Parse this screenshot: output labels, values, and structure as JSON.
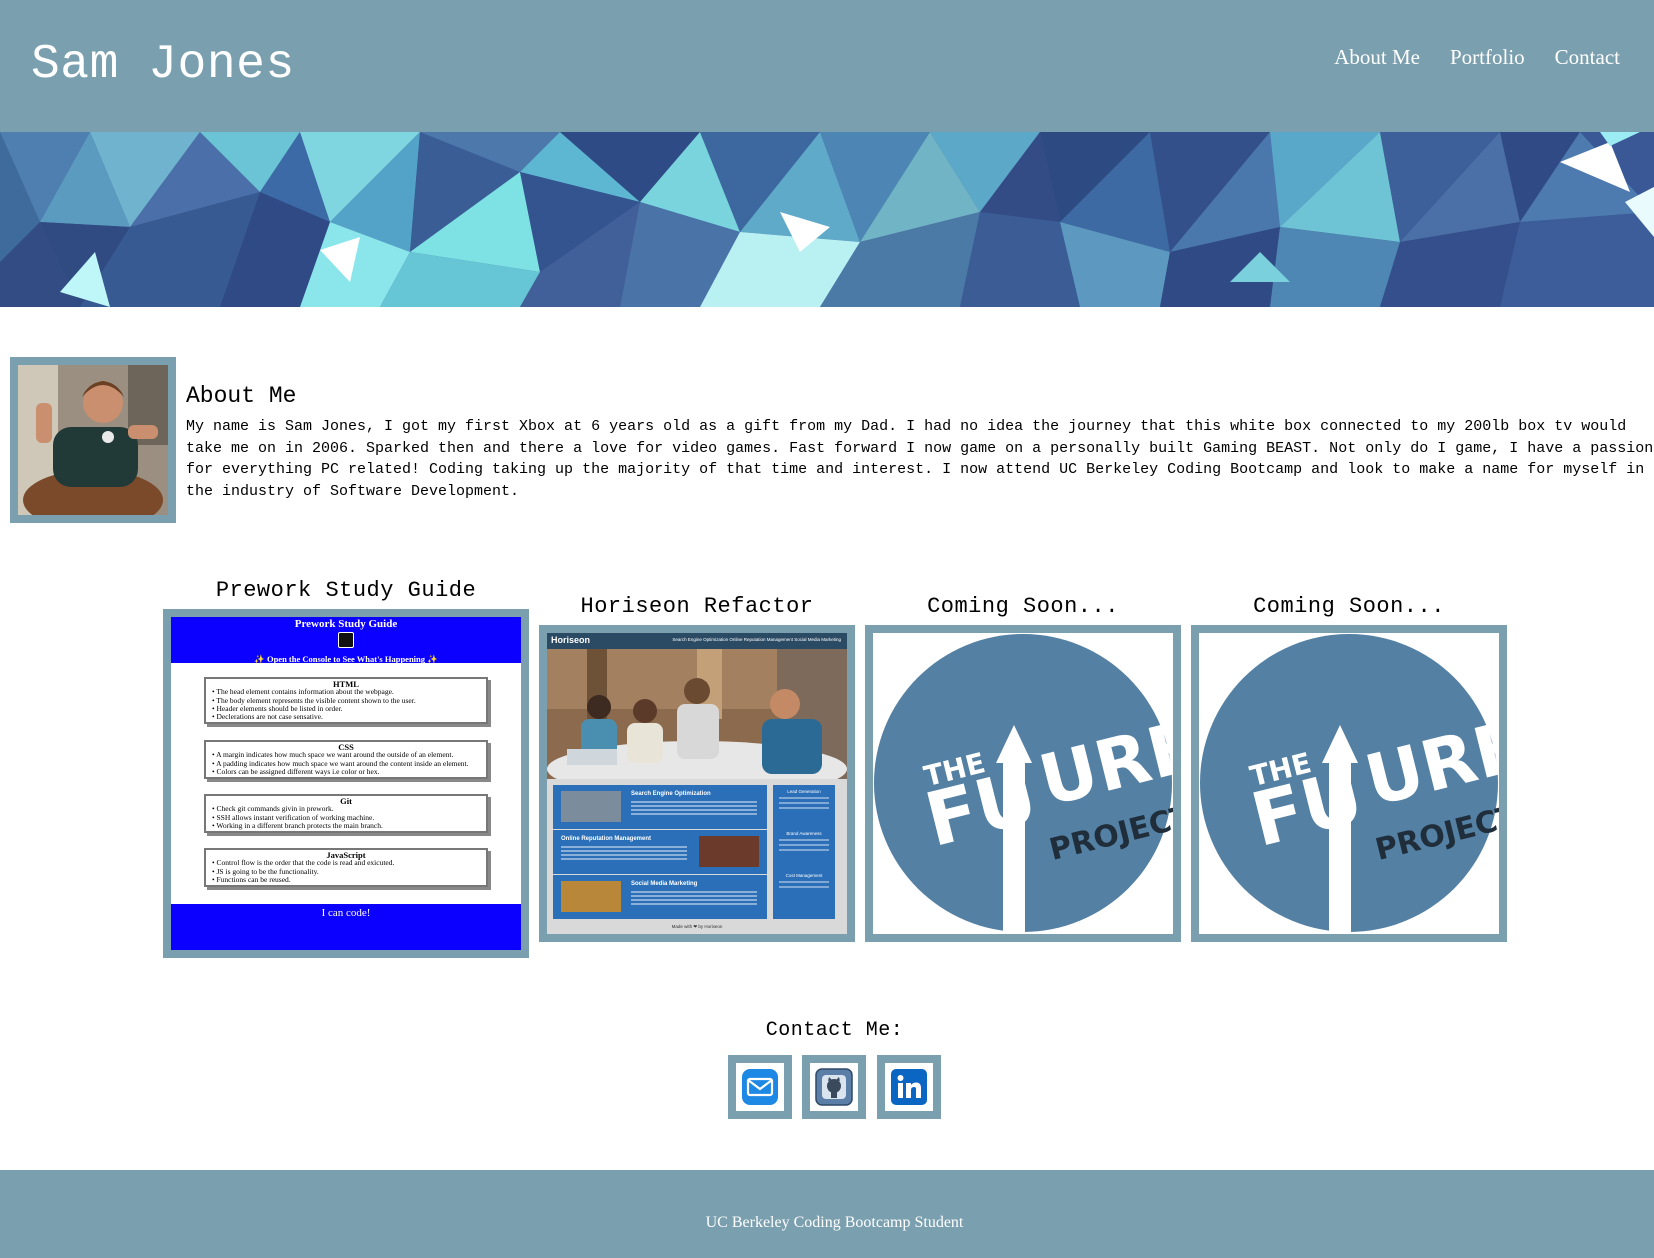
{
  "header": {
    "title": "Sam Jones",
    "nav": [
      "About Me",
      "Portfolio",
      "Contact"
    ]
  },
  "about": {
    "title": "About Me",
    "text": "My name is Sam Jones, I got my first Xbox at 6 years old as a gift from my Dad. I had no idea the journey that this white box connected to my 200lb box tv would take me on in 2006. Sparked then and there a love for video games. Fast forward I now game on a personally built Gaming BEAST. Not only do I game, I have a passion for everything PC related! Coding taking up the majority of that time and interest. I now attend UC Berkeley Coding Bootcamp and look to make a name for myself in the industry of Software Development."
  },
  "portfolio": {
    "items": [
      {
        "title": "Prework Study Guide"
      },
      {
        "title": "Horiseon Refactor"
      },
      {
        "title": "Coming Soon..."
      },
      {
        "title": "Coming Soon..."
      }
    ],
    "prework": {
      "heading": "Prework Study Guide",
      "subheading": "✨ Open the Console to See What's Happening ✨",
      "sections": [
        {
          "title": "HTML",
          "items": [
            "The head element contains information about the webpage.",
            "The body element represents the visible content shown to the user.",
            "Header elements should be listed in order.",
            "Declerations are not case sensative."
          ]
        },
        {
          "title": "CSS",
          "items": [
            "A margin indicates how much space we want around the outside of an element.",
            "A padding indicates how much space we want around the content inside an element.",
            "Colors can be assigned different ways i.e color or hex."
          ]
        },
        {
          "title": "Git",
          "items": [
            "Check git commands givin in prework.",
            "SSH allows instant verification of working machine.",
            "Working in a different branch protects the main branch."
          ]
        },
        {
          "title": "JavaScript",
          "items": [
            "Control flow is the order that the code is read and exicuted.",
            "JS is going to be the functionality.",
            "Functions can be reused."
          ]
        }
      ],
      "footer": "I can code!"
    },
    "horiseon": {
      "logo": "Horiseon",
      "nav": "Search Engine Optimization     Online Reputation Management     Social Media Marketing",
      "blocks": [
        "Search Engine Optimization",
        "Online Reputation Management",
        "Social Media Marketing"
      ],
      "side": [
        "Lead Generation",
        "Brand Awareness",
        "Cost Management"
      ],
      "footer": "Made with ❤ by Horiseon"
    },
    "future": {
      "line1": "THE",
      "line2": "FU",
      "line3": "URE",
      "line4": "PROJECT"
    }
  },
  "contact": {
    "title": "Contact Me:",
    "icons": [
      "mail-icon",
      "github-icon",
      "linkedin-icon"
    ]
  },
  "footer": {
    "text": "UC Berkeley Coding Bootcamp Student"
  },
  "colors": {
    "header_bg": "#7a9fae",
    "frame": "#7a9fae",
    "prework_blue": "#0b00ff",
    "future_circle": "#5480a3"
  }
}
